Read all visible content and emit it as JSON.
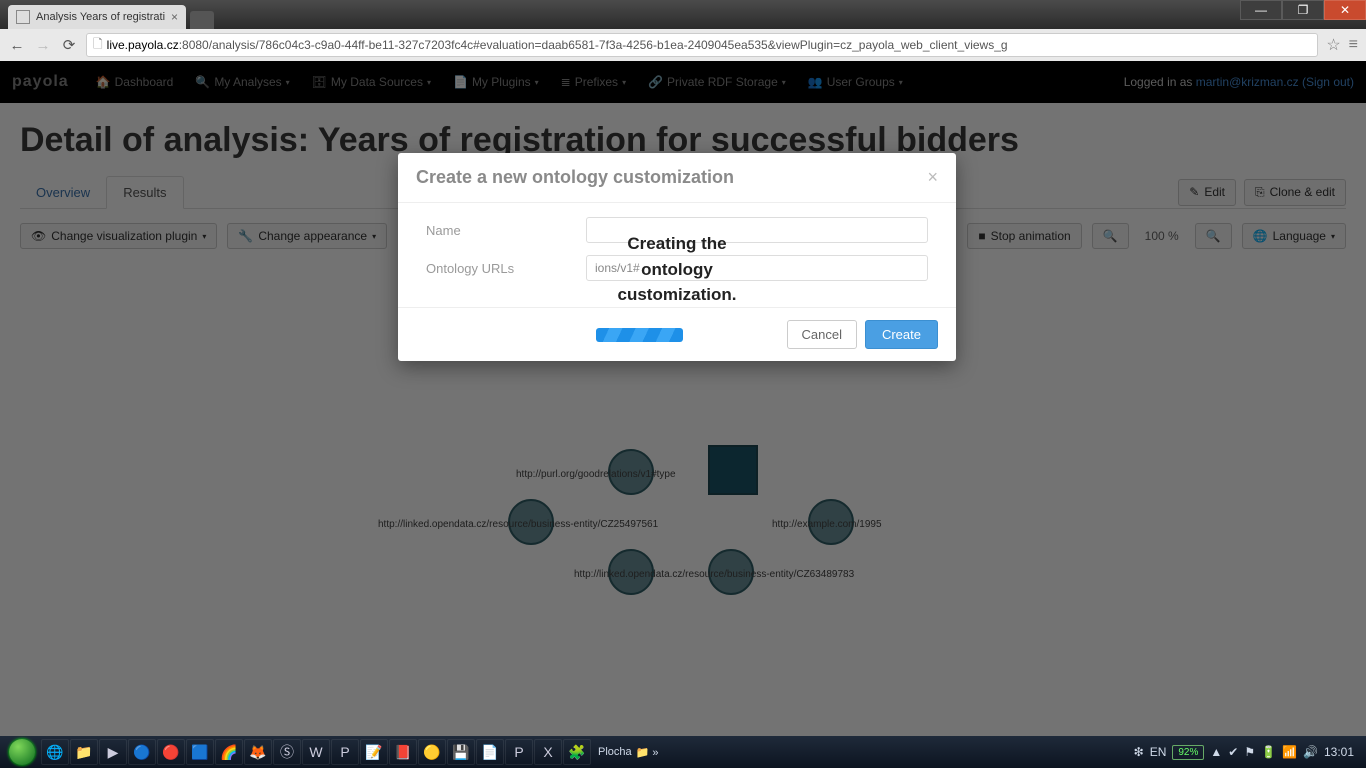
{
  "browser": {
    "tab_title": "Analysis Years of registrati",
    "url_host": "live.payola.cz",
    "url_path": ":8080/analysis/786c04c3-c9a0-44ff-be11-327c7203fc4c#evaluation=daab6581-7f3a-4256-b1ea-2409045ea535&viewPlugin=cz_payola_web_client_views_g"
  },
  "win": {
    "min": "—",
    "max": "❐",
    "close": "✕"
  },
  "nav": {
    "logo": "payola",
    "items": [
      "Dashboard",
      "My Analyses",
      "My Data Sources",
      "My Plugins",
      "Prefixes",
      "Private RDF Storage",
      "User Groups"
    ],
    "login_prefix": "Logged in as ",
    "login_user": "martin@krizman.cz",
    "signout": "(Sign out)"
  },
  "page": {
    "title": "Detail of analysis: Years of registration for successful bidders",
    "tabs": {
      "overview": "Overview",
      "results": "Results"
    },
    "edit": "Edit",
    "clone": "Clone & edit"
  },
  "toolbar": {
    "change_viz": "Change visualization plugin",
    "change_app": "Change appearance",
    "stop": "Stop animation",
    "zoom": "100 %",
    "lang": "Language"
  },
  "modal": {
    "title": "Create a new ontology customization",
    "name_label": "Name",
    "url_label": "Ontology URLs",
    "url_value": "ions/v1#",
    "creating_line1": "Creating the",
    "creating_line2": "ontology",
    "creating_line3": "customization.",
    "cancel": "Cancel",
    "create": "Create",
    "close": "×"
  },
  "graph": {
    "label1": "http://purl.org/goodrelations/v1#type",
    "label2": "http://linked.opendata.cz/resource/business-entity/CZ25497561",
    "label3": "http://example.com/1995",
    "label4": "http://linked.opendata.cz/resource/business-entity/CZ63489783"
  },
  "taskbar": {
    "label1": "Plocha",
    "lang": "EN",
    "battery": "92%",
    "time": "13:01"
  }
}
